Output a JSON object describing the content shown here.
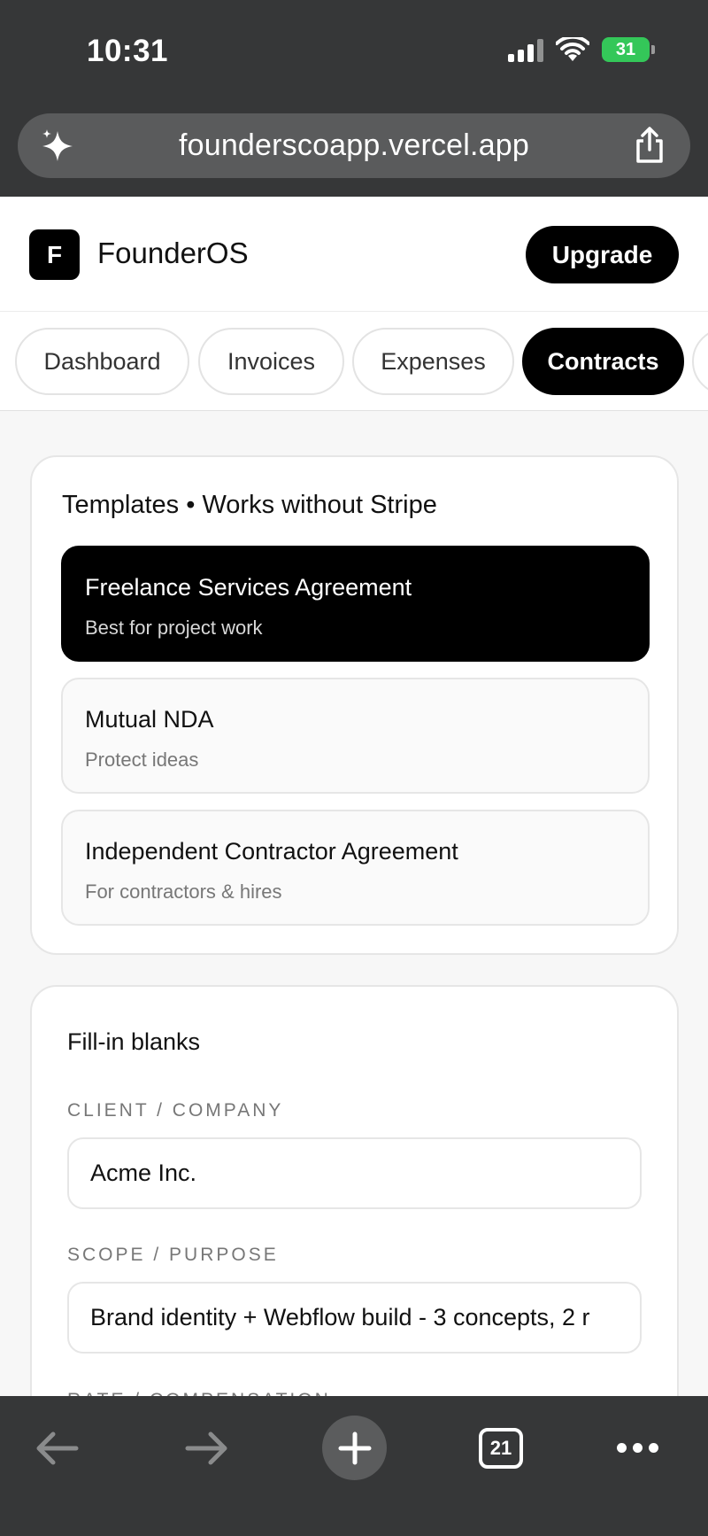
{
  "status_bar": {
    "time": "10:31",
    "battery": "31"
  },
  "browser": {
    "url": "founderscoapp.vercel.app",
    "tab_count": "21"
  },
  "header": {
    "logo_letter": "F",
    "brand": "FounderOS",
    "upgrade_label": "Upgrade"
  },
  "tabs": [
    {
      "label": "Dashboard"
    },
    {
      "label": "Invoices"
    },
    {
      "label": "Expenses"
    },
    {
      "label": "Contracts"
    }
  ],
  "templates": {
    "title": "Templates • Works without Stripe",
    "items": [
      {
        "name": "Freelance Services Agreement",
        "desc": "Best for project work"
      },
      {
        "name": "Mutual NDA",
        "desc": "Protect ideas"
      },
      {
        "name": "Independent Contractor Agreement",
        "desc": "For contractors & hires"
      }
    ]
  },
  "fill_in": {
    "title": "Fill-in blanks",
    "client_label": "CLIENT / COMPANY",
    "client_value": "Acme Inc.",
    "scope_label": "SCOPE / PURPOSE",
    "scope_value": "Brand identity + Webflow build - 3 concepts, 2 r",
    "rate_label": "RATE / COMPENSATION"
  },
  "colors": {
    "accent": "#000000",
    "chrome": "#363738",
    "battery": "#34c759"
  }
}
